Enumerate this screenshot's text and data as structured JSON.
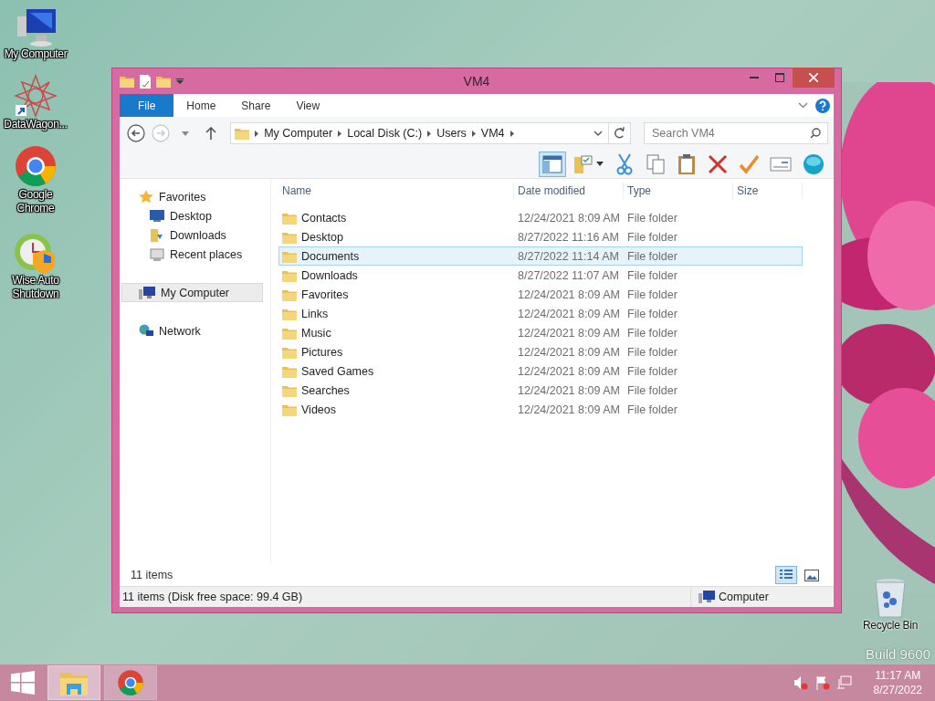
{
  "desktop_icons": [
    {
      "kind": "computer",
      "label": "My Computer"
    },
    {
      "kind": "star",
      "label": "DataWagon..."
    },
    {
      "kind": "chrome",
      "label": "Google Chrome"
    },
    {
      "kind": "clock",
      "label": "Wise Auto Shutdown"
    }
  ],
  "window": {
    "title": "VM4",
    "ribbon_tabs": [
      {
        "kind": "file",
        "label": "File",
        "selected": false
      },
      {
        "kind": "tab",
        "label": "Home",
        "selected": false
      },
      {
        "kind": "tab",
        "label": "Share",
        "selected": false
      },
      {
        "kind": "tab",
        "label": "View",
        "selected": false
      }
    ],
    "breadcrumbs": [
      "My Computer",
      "Local Disk (C:)",
      "Users",
      "VM4"
    ],
    "search": {
      "placeholder": "Search VM4"
    },
    "toolbar": [
      {
        "kind": "preview",
        "on": true
      },
      {
        "kind": "folder-check",
        "on": false
      },
      {
        "kind": "cut",
        "on": false
      },
      {
        "kind": "copy",
        "on": false
      },
      {
        "kind": "paste",
        "on": false
      },
      {
        "kind": "delete",
        "on": false
      },
      {
        "kind": "check",
        "on": false
      },
      {
        "kind": "rename",
        "on": false
      },
      {
        "kind": "shell",
        "on": false
      }
    ],
    "nav": [
      {
        "kind": "star",
        "label": "Favorites",
        "selected": false,
        "children": [
          {
            "kind": "desktop",
            "label": "Desktop",
            "selected": false
          },
          {
            "kind": "download",
            "label": "Downloads",
            "selected": false
          },
          {
            "kind": "recent",
            "label": "Recent places",
            "selected": false
          }
        ]
      },
      {
        "kind": "computer",
        "label": "My Computer",
        "selected": true
      },
      {
        "kind": "network",
        "label": "Network",
        "selected": false
      }
    ],
    "columns": [
      "Name",
      "Date modified",
      "Type",
      "Size"
    ],
    "rows": [
      {
        "name": "Contacts",
        "date": "12/24/2021 8:09 AM",
        "type": "File folder",
        "selected": false
      },
      {
        "name": "Desktop",
        "date": "8/27/2022 11:16 AM",
        "type": "File folder",
        "selected": false
      },
      {
        "name": "Documents",
        "date": "8/27/2022 11:14 AM",
        "type": "File folder",
        "selected": true
      },
      {
        "name": "Downloads",
        "date": "8/27/2022 11:07 AM",
        "type": "File folder",
        "selected": false
      },
      {
        "name": "Favorites",
        "date": "12/24/2021 8:09 AM",
        "type": "File folder",
        "selected": false
      },
      {
        "name": "Links",
        "date": "12/24/2021 8:09 AM",
        "type": "File folder",
        "selected": false
      },
      {
        "name": "Music",
        "date": "12/24/2021 8:09 AM",
        "type": "File folder",
        "selected": false
      },
      {
        "name": "Pictures",
        "date": "12/24/2021 8:09 AM",
        "type": "File folder",
        "selected": false
      },
      {
        "name": "Saved Games",
        "date": "12/24/2021 8:09 AM",
        "type": "File folder",
        "selected": false
      },
      {
        "name": "Searches",
        "date": "12/24/2021 8:09 AM",
        "type": "File folder",
        "selected": false
      },
      {
        "name": "Videos",
        "date": "12/24/2021 8:09 AM",
        "type": "File folder",
        "selected": false
      }
    ],
    "item_count": "11 items",
    "views": [
      {
        "kind": "details",
        "selected": true
      },
      {
        "kind": "thumbnails",
        "selected": false
      }
    ],
    "status": {
      "text": "11 items (Disk free space: 99.4 GB)",
      "location": "Computer"
    }
  },
  "recycle_bin": {
    "label": "Recycle Bin"
  },
  "watermark": "Build 9600",
  "taskbar": {
    "apps": [
      {
        "kind": "explorer",
        "selected": true
      },
      {
        "kind": "chrome",
        "selected": false
      }
    ],
    "time": "11:17 AM",
    "date": "8/27/2022"
  }
}
